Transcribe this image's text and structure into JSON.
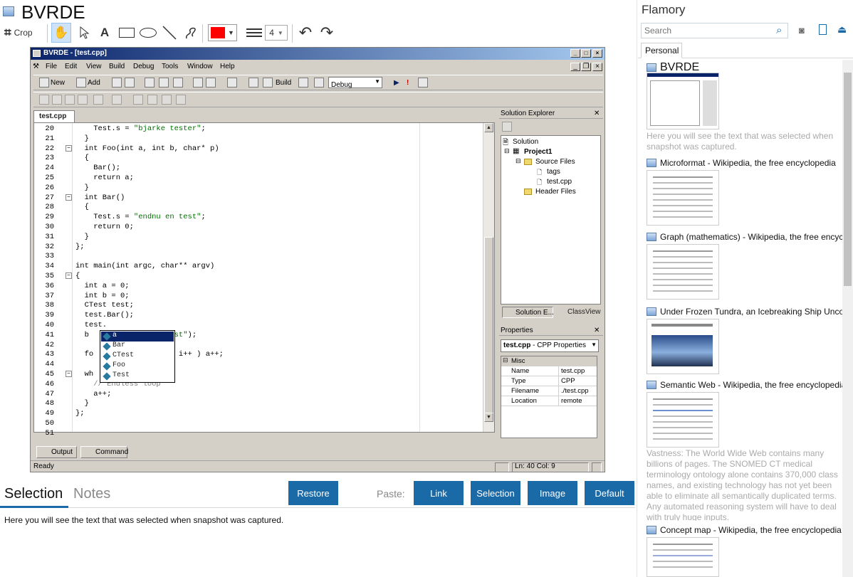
{
  "app": {
    "title": "BVRDE"
  },
  "toolbar": {
    "crop_label": "Crop",
    "line_width": "4",
    "color": "#ff0000"
  },
  "ide": {
    "caption": "BVRDE - [test.cpp]",
    "menu": [
      "File",
      "Edit",
      "View",
      "Build",
      "Debug",
      "Tools",
      "Window",
      "Help"
    ],
    "toolbar": {
      "new_label": "New",
      "add_label": "Add",
      "build_label": "Build",
      "config": "Debug"
    },
    "tab": "test.cpp",
    "code_lines": [
      {
        "n": "20",
        "t": "    Test.s = ",
        "s": "\"bjarke tester\"",
        "e": ";"
      },
      {
        "n": "21",
        "t": "  }"
      },
      {
        "n": "22",
        "t": "  int Foo(int a, int b, char* p)",
        "fold": true
      },
      {
        "n": "23",
        "t": "  {"
      },
      {
        "n": "24",
        "t": "    Bar();"
      },
      {
        "n": "25",
        "t": "    return a;"
      },
      {
        "n": "26",
        "t": "  }"
      },
      {
        "n": "27",
        "t": "  int Bar()",
        "fold": true
      },
      {
        "n": "28",
        "t": "  {"
      },
      {
        "n": "29",
        "t": "    Test.s = ",
        "s": "\"endnu en test\"",
        "e": ";"
      },
      {
        "n": "30",
        "t": "    return 0;"
      },
      {
        "n": "31",
        "t": "  }"
      },
      {
        "n": "32",
        "t": "};"
      },
      {
        "n": "33",
        "t": ""
      },
      {
        "n": "34",
        "t": "int main(int argc, char** argv)"
      },
      {
        "n": "35",
        "t": "{",
        "fold": true
      },
      {
        "n": "36",
        "t": "  int a = 0;"
      },
      {
        "n": "37",
        "t": "  int b = 0;"
      },
      {
        "n": "38",
        "t": "  CTest test;"
      },
      {
        "n": "39",
        "t": "  test.Bar();"
      },
      {
        "n": "40",
        "t": "  test."
      },
      {
        "n": "41",
        "t": "  b                 ",
        "s": "test\"",
        "e": ");"
      },
      {
        "n": "42",
        "t": ""
      },
      {
        "n": "43",
        "t": "  fo                3; i++ ) a++;"
      },
      {
        "n": "44",
        "t": ""
      },
      {
        "n": "45",
        "t": "  wh",
        "fold": true
      },
      {
        "n": "46",
        "t": "    ",
        "c": "// Endless loop"
      },
      {
        "n": "47",
        "t": "    a++;"
      },
      {
        "n": "48",
        "t": "  }"
      },
      {
        "n": "49",
        "t": "};"
      },
      {
        "n": "50",
        "t": ""
      },
      {
        "n": "51",
        "t": ""
      }
    ],
    "autocomplete": [
      "a",
      "Bar",
      "CTest",
      "Foo",
      "Test"
    ],
    "solution_explorer": {
      "title": "Solution Explorer",
      "items": [
        "Solution",
        "Project1",
        "Source Files",
        "tags",
        "test.cpp",
        "Header Files"
      ],
      "tabs": [
        "Solution E...",
        "ClassView"
      ]
    },
    "properties": {
      "title": "Properties",
      "selector_bold": "test.cpp",
      "selector_rest": " - CPP Properties",
      "group": "Misc",
      "rows": [
        {
          "k": "Name",
          "v": "test.cpp"
        },
        {
          "k": "Type",
          "v": "CPP"
        },
        {
          "k": "Filename",
          "v": "./test.cpp"
        },
        {
          "k": "Location",
          "v": "remote"
        }
      ]
    },
    "output_tabs": [
      "Output",
      "Command"
    ],
    "status": {
      "left": "Ready",
      "pos": "Ln: 40 Col: 9"
    }
  },
  "bottom": {
    "tabs": [
      "Selection",
      "Notes"
    ],
    "restore": "Restore",
    "paste_label": "Paste:",
    "paste_buttons": [
      "Link",
      "Selection",
      "Image",
      "Default"
    ],
    "selection_text": "Here you will see the text that was selected when snapshot was captured."
  },
  "right": {
    "title": "Flamory",
    "search_placeholder": "Search",
    "tab": "Personal",
    "items": [
      {
        "title": "BVRDE",
        "desc": "Here you will see the text that was selected when snapshot was captured."
      },
      {
        "title": "Microformat - Wikipedia, the free encyclopedia"
      },
      {
        "title": "Graph (mathematics) - Wikipedia, the free encyclopedia"
      },
      {
        "title": "Under Frozen Tundra, an Icebreaking Ship Uncovers"
      },
      {
        "title": "Semantic Web - Wikipedia, the free encyclopedia",
        "desc": "Vastness: The World Wide Web contains many billions of pages. The SNOMED CT medical terminology ontology alone contains 370,000 class names, and existing technology has not yet been able to eliminate all semantically duplicated terms. Any automated reasoning system will have to deal with truly huge inputs."
      },
      {
        "title": "Concept map - Wikipedia, the free encyclopedia"
      }
    ]
  }
}
